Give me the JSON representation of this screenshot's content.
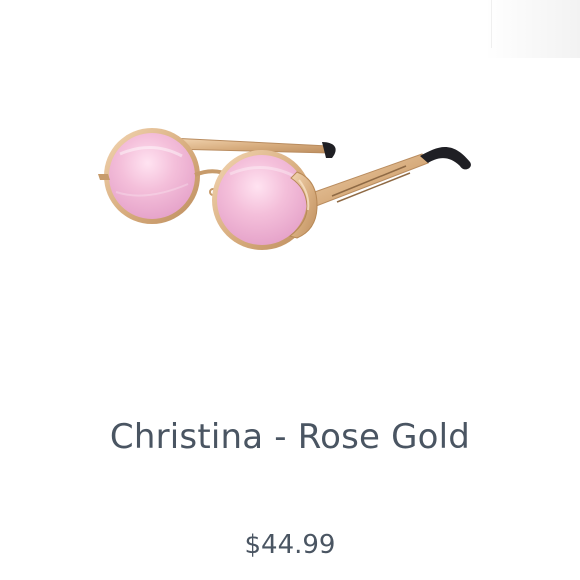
{
  "product": {
    "title": "Christina - Rose Gold",
    "price": "$44.99",
    "image_icon": "round-sunglasses-icon"
  },
  "colors": {
    "text": "#4a5562",
    "frame_gold": "#d9b48a",
    "lens_pink": "#f2b6d6",
    "temple_tip": "#1f1f24"
  }
}
